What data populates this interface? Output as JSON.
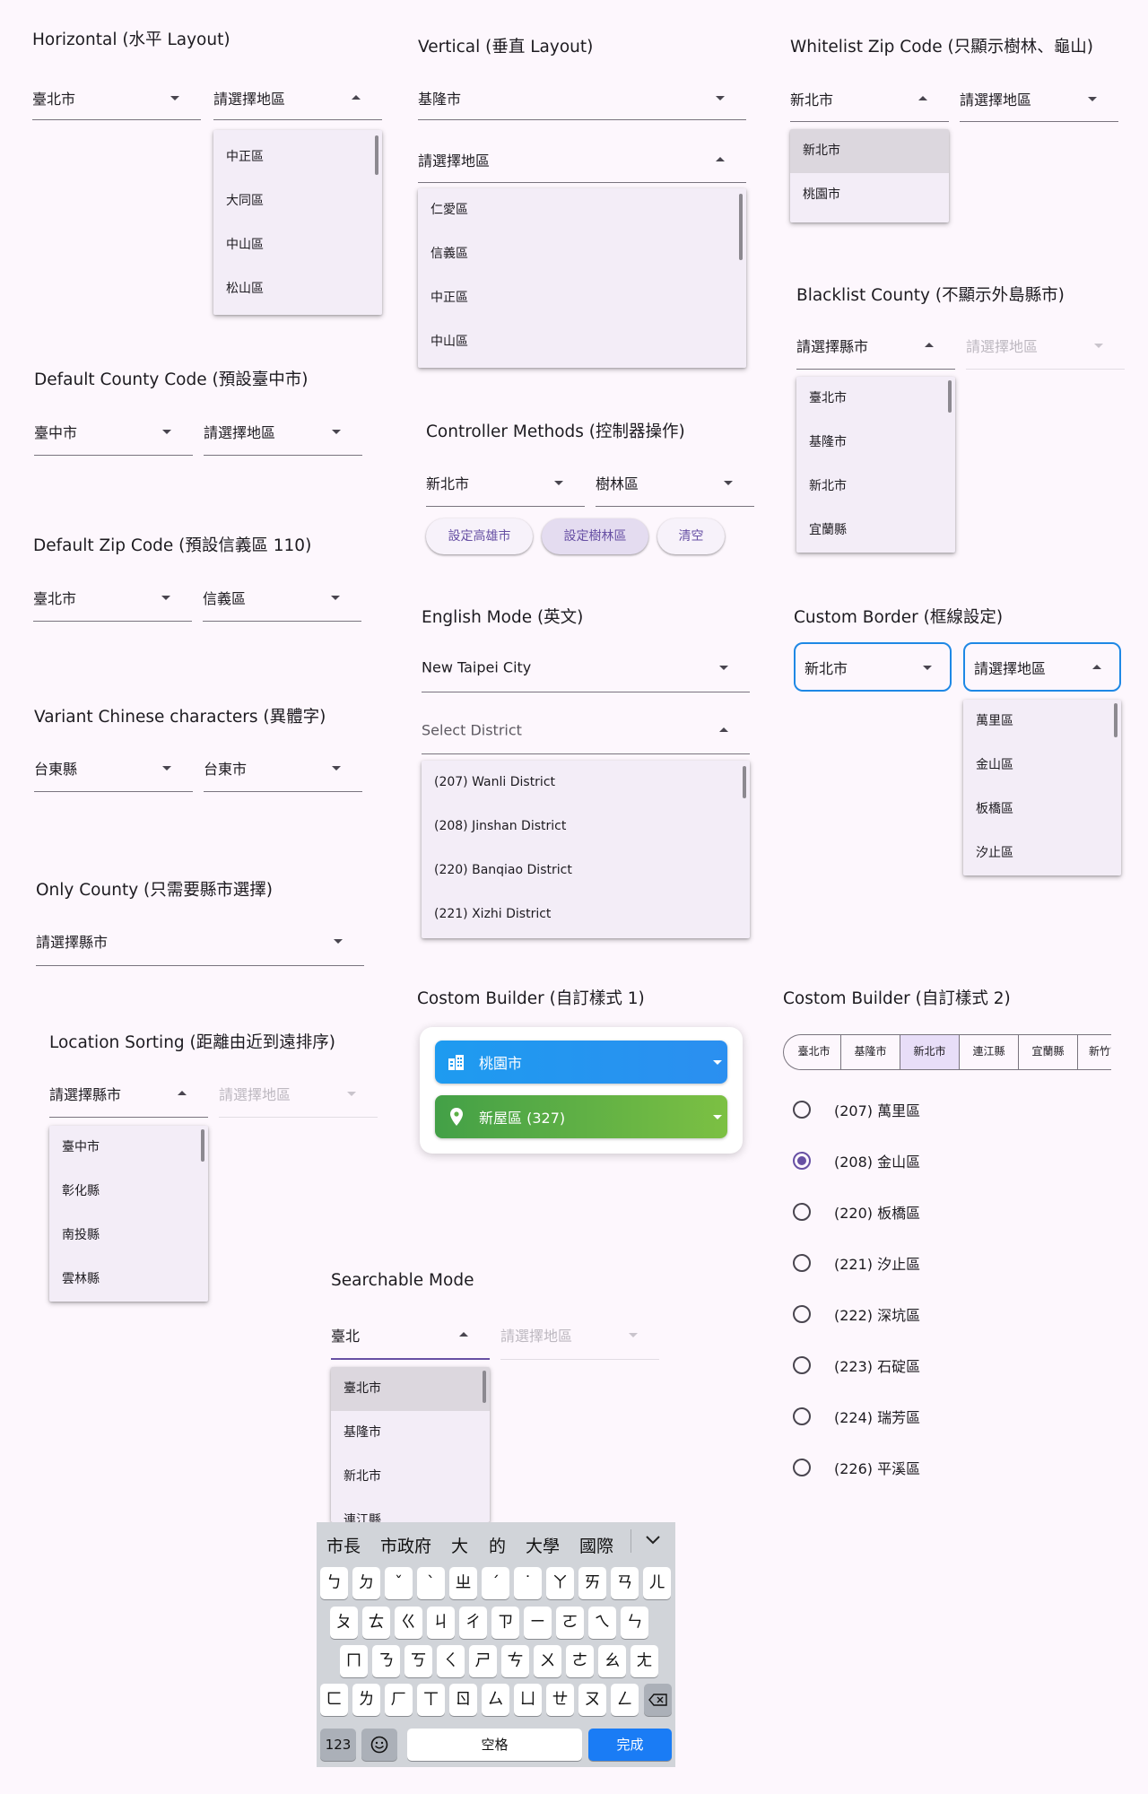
{
  "horizontal": {
    "title": "Horizontal (水平 Layout)",
    "county": "臺北市",
    "district": "請選擇地區",
    "options": [
      "中正區",
      "大同區",
      "中山區",
      "松山區"
    ]
  },
  "vertical": {
    "title": "Vertical (垂直 Layout)",
    "county": "基隆市",
    "district": "請選擇地區",
    "options": [
      "仁愛區",
      "信義區",
      "中正區",
      "中山區"
    ]
  },
  "whitelist": {
    "title": "Whitelist Zip Code (只顯示樹林、龜山)",
    "county": "新北市",
    "district": "請選擇地區",
    "options": [
      "新北市",
      "桃園市"
    ]
  },
  "blacklist": {
    "title": "Blacklist County (不顯示外島縣市)",
    "county": "請選擇縣市",
    "district": "請選擇地區",
    "options": [
      "臺北市",
      "基隆市",
      "新北市",
      "宜蘭縣"
    ]
  },
  "default_county": {
    "title": "Default County Code (預設臺中市)",
    "county": "臺中市",
    "district": "請選擇地區"
  },
  "controller": {
    "title": "Controller Methods (控制器操作)",
    "county": "新北市",
    "district": "樹林區",
    "buttons": [
      "設定高雄市",
      "設定樹林區",
      "清空"
    ]
  },
  "default_zip": {
    "title": "Default Zip Code (預設信義區 110)",
    "county": "臺北市",
    "district": "信義區"
  },
  "english": {
    "title": "English Mode (英文)",
    "county": "New Taipei City",
    "district": "Select District",
    "options": [
      "(207) Wanli District",
      "(208) Jinshan District",
      "(220) Banqiao District",
      "(221) Xizhi District"
    ]
  },
  "custom_border": {
    "title": "Custom Border (框線設定)",
    "county": "新北市",
    "district": "請選擇地區",
    "options": [
      "萬里區",
      "金山區",
      "板橋區",
      "汐止區"
    ]
  },
  "variant": {
    "title": "Variant Chinese characters (異體字)",
    "county": "台東縣",
    "district": "台東市"
  },
  "only_county": {
    "title": "Only County (只需要縣市選擇)",
    "county": "請選擇縣市"
  },
  "builder1": {
    "title": "Costom Builder (自訂樣式 1)",
    "county": "桃園市",
    "district": "新屋區 (327)",
    "colors": {
      "blue_from": "#1e9bf0",
      "blue_to": "#2b8ff0",
      "green_from": "#43a047",
      "green_to": "#7cc043"
    }
  },
  "builder2": {
    "title": "Costom Builder (自訂樣式 2)",
    "segments": [
      "臺北市",
      "基隆市",
      "新北市",
      "連江縣",
      "宜蘭縣",
      "新竹市"
    ],
    "selected_segment": "新北市",
    "districts": [
      "(207) 萬里區",
      "(208) 金山區",
      "(220) 板橋區",
      "(221) 汐止區",
      "(222) 深坑區",
      "(223) 石碇區",
      "(224) 瑞芳區",
      "(226) 平溪區"
    ],
    "selected_district": "(208) 金山區"
  },
  "sorting": {
    "title": "Location Sorting (距離由近到遠排序)",
    "county": "請選擇縣市",
    "district": "請選擇地區",
    "options": [
      "臺中市",
      "彰化縣",
      "南投縣",
      "雲林縣"
    ]
  },
  "searchable": {
    "title": "Searchable Mode",
    "county": "臺北",
    "district": "請選擇地區",
    "options": [
      "臺北市",
      "基隆市",
      "新北市",
      "連江縣"
    ]
  },
  "keyboard": {
    "candidates": [
      "市長",
      "市政府",
      "大",
      "的",
      "大學",
      "國際"
    ],
    "row1": [
      "ㄅ",
      "ㄉ",
      "ˇ",
      "ˋ",
      "ㄓ",
      "ˊ",
      "˙",
      "ㄚ",
      "ㄞ",
      "ㄢ",
      "ㄦ"
    ],
    "row2": [
      "ㄆ",
      "ㄊ",
      "ㄍ",
      "ㄐ",
      "ㄔ",
      "ㄗ",
      "ㄧ",
      "ㄛ",
      "ㄟ",
      "ㄣ"
    ],
    "row3": [
      "ㄇ",
      "ㄋ",
      "ㄎ",
      "ㄑ",
      "ㄕ",
      "ㄘ",
      "ㄨ",
      "ㄜ",
      "ㄠ",
      "ㄤ"
    ],
    "row4": [
      "ㄈ",
      "ㄌ",
      "ㄏ",
      "ㄒ",
      "ㄖ",
      "ㄙ",
      "ㄩ",
      "ㄝ",
      "ㄡ",
      "ㄥ"
    ],
    "num_key": "123",
    "space_key": "空格",
    "done_key": "完成",
    "accent": "#1a7cf5"
  }
}
